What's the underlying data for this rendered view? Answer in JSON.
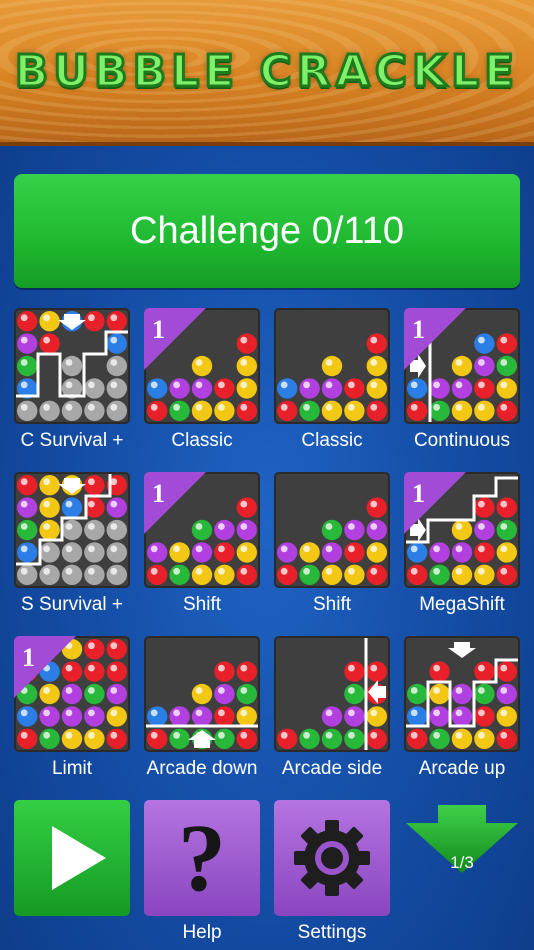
{
  "app": {
    "title": "BUBBLE CRACKLE"
  },
  "challenge": {
    "label": "Challenge 0/110"
  },
  "modes": [
    {
      "label": "C Survival +",
      "badge": ""
    },
    {
      "label": "Classic",
      "badge": "1"
    },
    {
      "label": "Classic",
      "badge": ""
    },
    {
      "label": "Continuous",
      "badge": "1"
    },
    {
      "label": "S Survival +",
      "badge": ""
    },
    {
      "label": "Shift",
      "badge": "1"
    },
    {
      "label": "Shift",
      "badge": ""
    },
    {
      "label": "MegaShift",
      "badge": "1"
    },
    {
      "label": "Limit",
      "badge": "1"
    },
    {
      "label": "Arcade down",
      "badge": ""
    },
    {
      "label": "Arcade side",
      "badge": ""
    },
    {
      "label": "Arcade up",
      "badge": ""
    }
  ],
  "bottom": {
    "play_label": "",
    "help_label": "Help",
    "help_glyph": "?",
    "settings_label": "Settings",
    "page_indicator": "1/3"
  },
  "colors": {
    "green_button": "#1fb830",
    "purple_button": "#9a55cc",
    "badge": "#a24bd6"
  }
}
